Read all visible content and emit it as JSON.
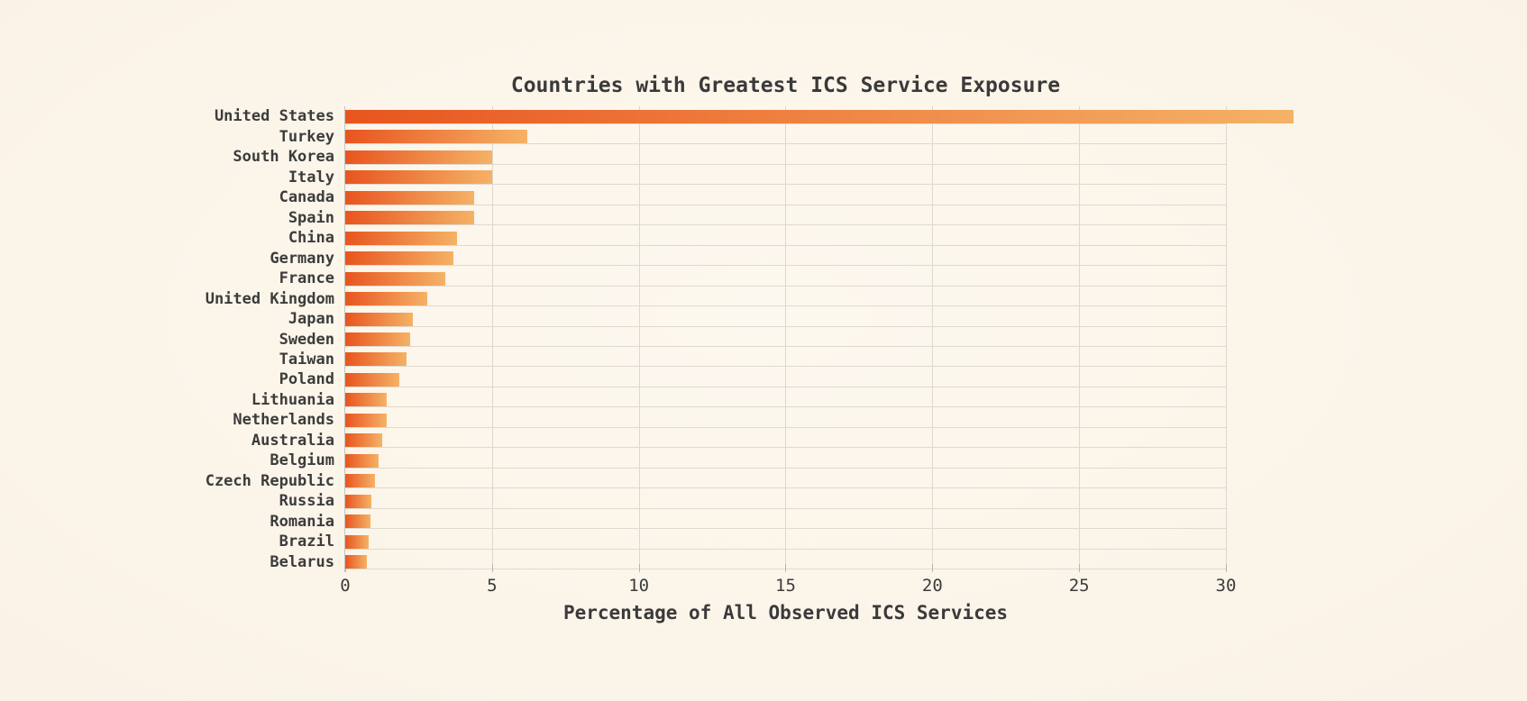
{
  "chart_data": {
    "type": "bar",
    "orientation": "horizontal",
    "title": "Countries with Greatest ICS Service Exposure",
    "subtitle": "",
    "xlabel": "Percentage of All Observed ICS Services",
    "ylabel": "",
    "xlim": [
      0,
      32.8
    ],
    "ylim": null,
    "grid": "both",
    "legend": null,
    "xticks": [
      0,
      5,
      10,
      15,
      20,
      25,
      30
    ],
    "xtick_labels": [
      "0",
      "5",
      "10",
      "15",
      "20",
      "25",
      "30"
    ],
    "categories": [
      "United States",
      "Turkey",
      "South Korea",
      "Italy",
      "Canada",
      "Spain",
      "China",
      "Germany",
      "France",
      "United Kingdom",
      "Japan",
      "Sweden",
      "Taiwan",
      "Poland",
      "Lithuania",
      "Netherlands",
      "Australia",
      "Belgium",
      "Czech Republic",
      "Russia",
      "Romania",
      "Brazil",
      "Belarus"
    ],
    "values": [
      32.3,
      6.2,
      5.0,
      5.0,
      4.4,
      4.4,
      3.8,
      3.7,
      3.4,
      2.8,
      2.3,
      2.2,
      2.1,
      1.85,
      1.4,
      1.4,
      1.25,
      1.15,
      1.0,
      0.9,
      0.85,
      0.8,
      0.75
    ],
    "colors": {
      "background": "#fbf4e9",
      "bar_gradient_start": "#e8551f",
      "bar_gradient_end": "#f5b266",
      "grid": "#ddd8cd",
      "axis": "#c9c4b8",
      "text": "#3a3a3a"
    }
  }
}
